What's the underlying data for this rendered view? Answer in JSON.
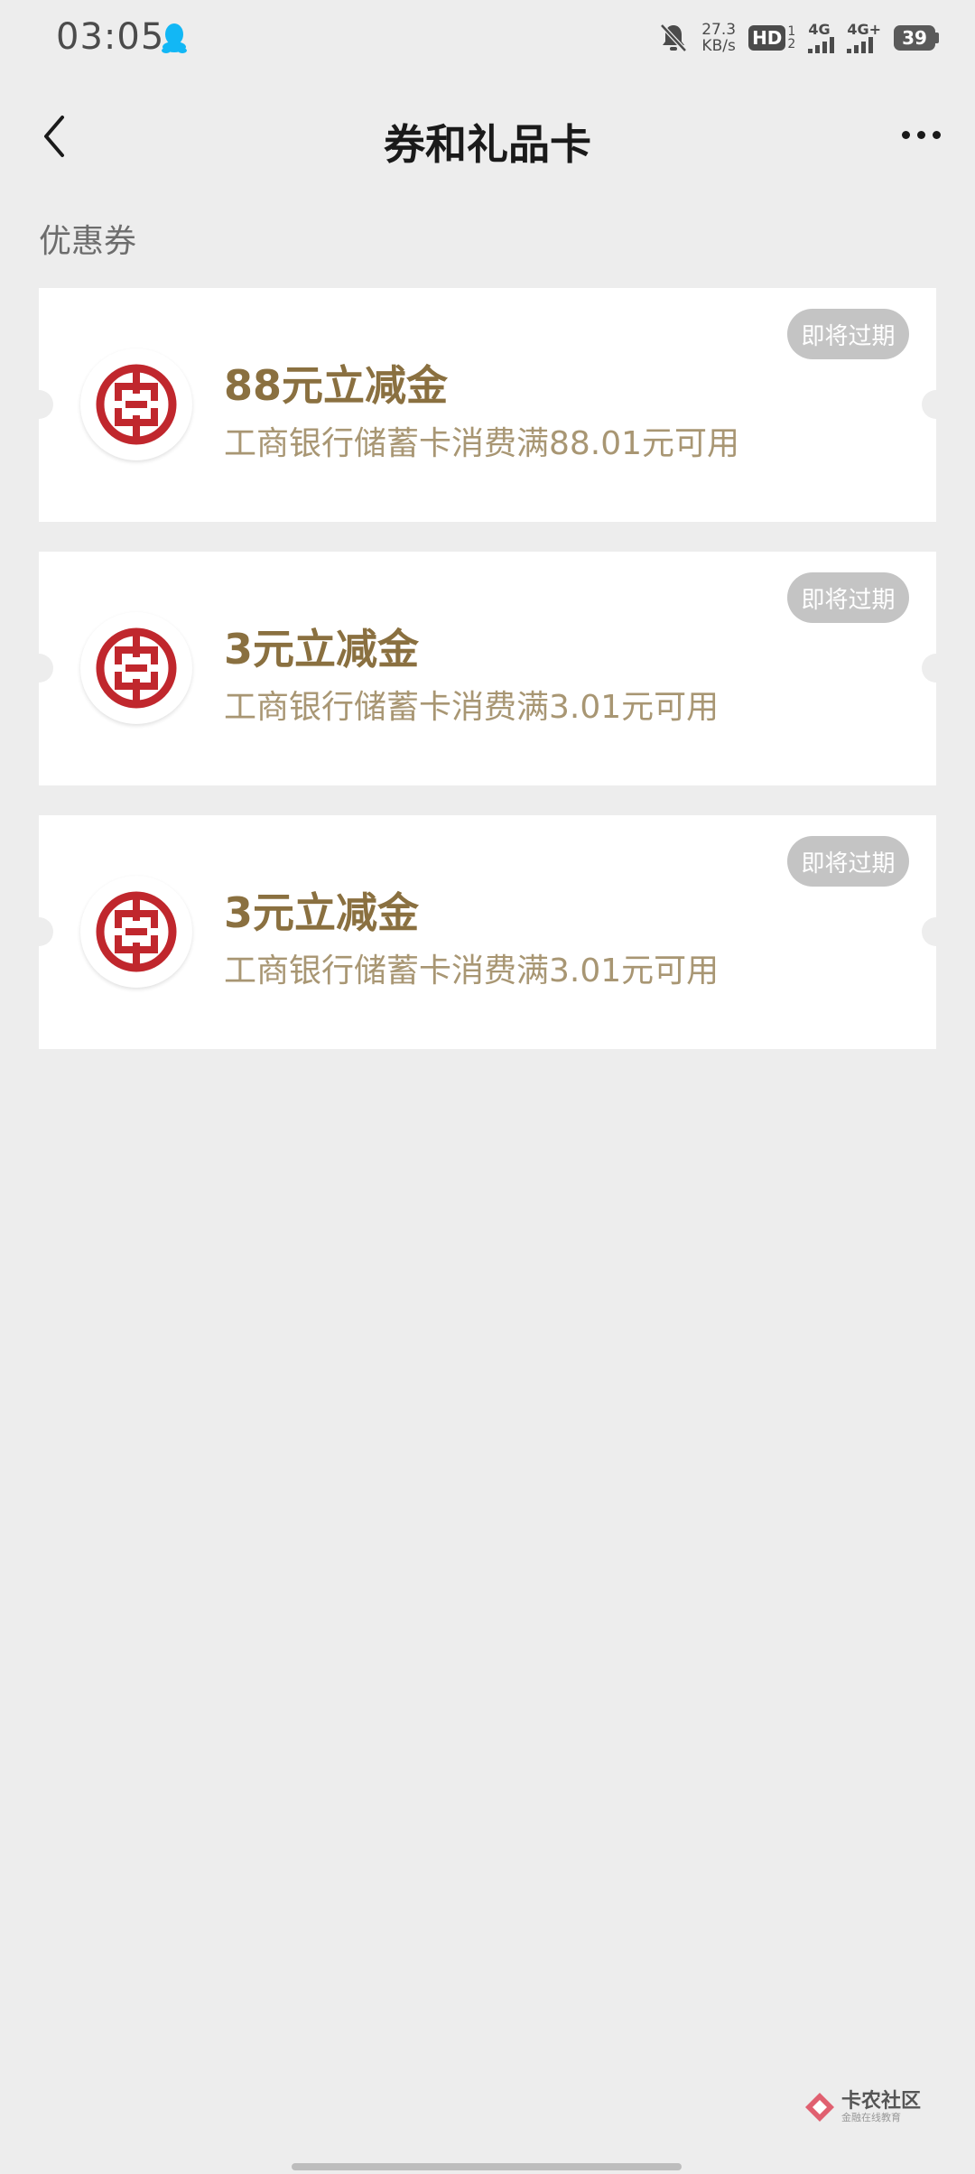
{
  "status_bar": {
    "time": "03:05",
    "speed_value": "27.3",
    "speed_unit": "KB/s",
    "hd_label": "HD",
    "hd_sup": "1",
    "hd_sub": "2",
    "sim1_label": "4G",
    "sim2_label": "4G+",
    "battery": "39",
    "icons": [
      "qq-icon",
      "mute-bell-icon",
      "signal-icon",
      "battery-icon"
    ]
  },
  "nav": {
    "title": "券和礼品卡",
    "back_icon": "chevron-left-icon",
    "more_icon": "more-dots-icon"
  },
  "section": {
    "title": "优惠券"
  },
  "coupons": [
    {
      "name": "88元立减金",
      "desc": "工商银行储蓄卡消费满88.01元可用",
      "badge": "即将过期",
      "logo": "icbc-logo"
    },
    {
      "name": "3元立减金",
      "desc": "工商银行储蓄卡消费满3.01元可用",
      "badge": "即将过期",
      "logo": "icbc-logo"
    },
    {
      "name": "3元立减金",
      "desc": "工商银行储蓄卡消费满3.01元可用",
      "badge": "即将过期",
      "logo": "icbc-logo"
    }
  ],
  "watermark": {
    "main": "卡农社区",
    "sub": "金融在线教育"
  },
  "colors": {
    "background": "#ededed",
    "coupon_title": "#8a7040",
    "coupon_desc": "#a89673",
    "badge_bg": "#c4c4c4",
    "icbc_red": "#c0272d"
  }
}
